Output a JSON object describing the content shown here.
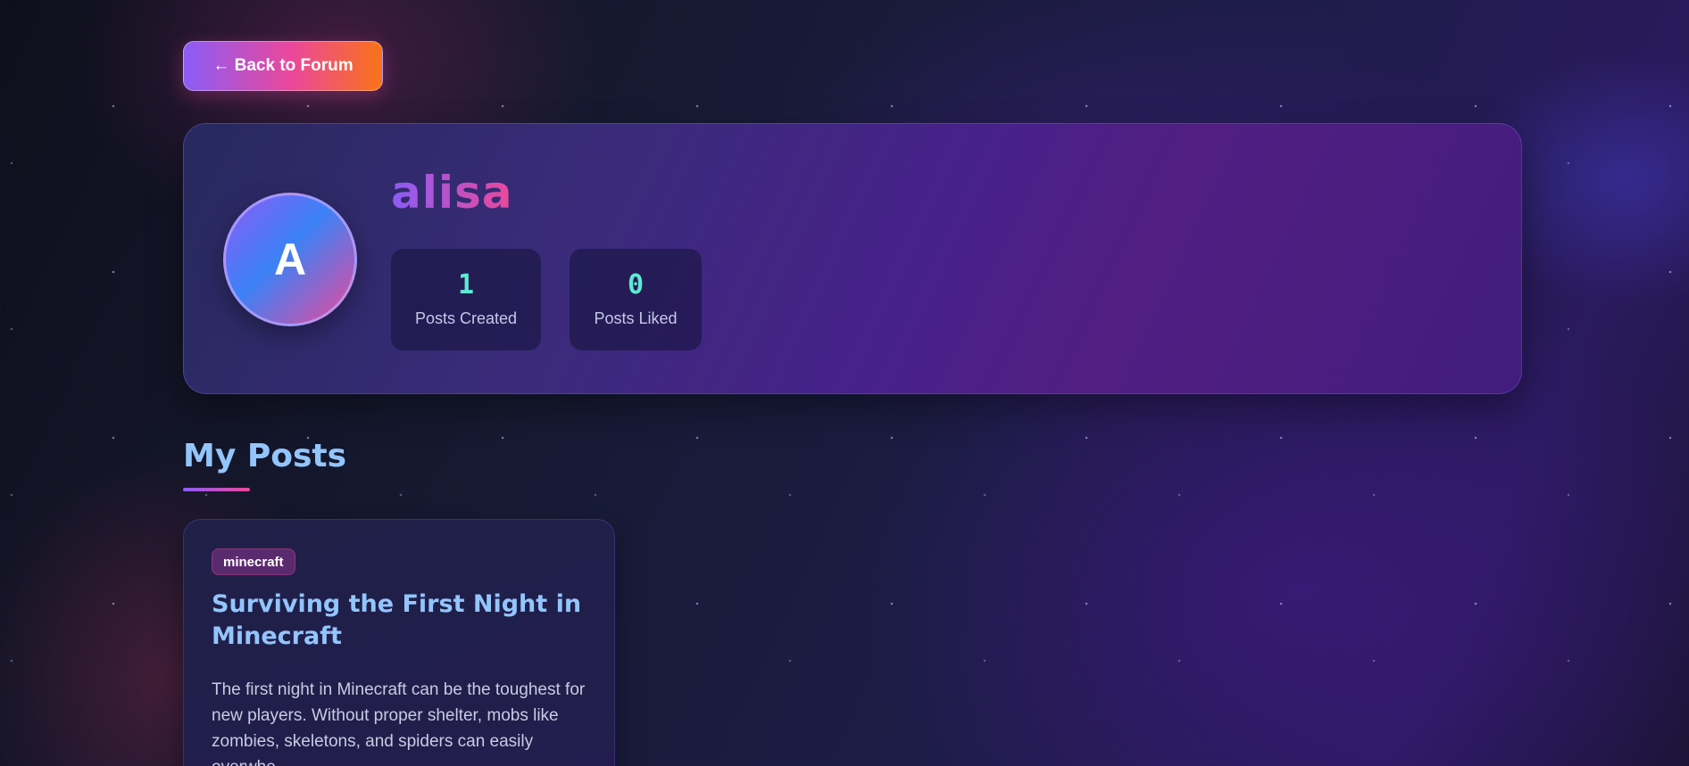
{
  "nav": {
    "back_label": "← Back to Forum"
  },
  "profile": {
    "avatar_letter": "A",
    "username": "alisa",
    "stats": [
      {
        "value": "1",
        "label": "Posts Created"
      },
      {
        "value": "0",
        "label": "Posts Liked"
      }
    ]
  },
  "posts_section": {
    "title": "My Posts",
    "posts": [
      {
        "tag": "minecraft",
        "title": "Surviving the First Night in Minecraft",
        "excerpt": "The first night in Minecraft can be the toughest for new players. Without proper shelter, mobs like zombies, skeletons, and spiders can easily overwhe..."
      }
    ]
  },
  "colors": {
    "accent_purple": "#8b5cf6",
    "accent_pink": "#ec4899",
    "accent_orange": "#f97316",
    "stat_teal": "#5eead4",
    "title_blue": "#93c5fd"
  }
}
